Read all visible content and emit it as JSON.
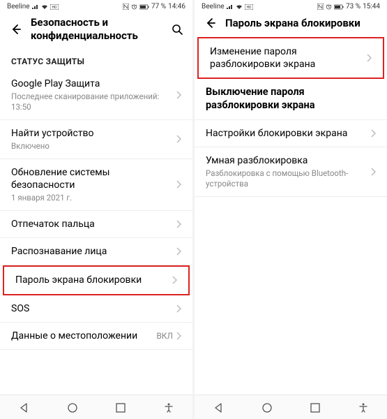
{
  "left": {
    "statusbar": {
      "carrier": "Beeline",
      "battery": "77 %",
      "time": "14:46"
    },
    "header": {
      "title": "Безопасность и конфиденциальность"
    },
    "section_label": "СТАТУС ЗАЩИТЫ",
    "items": [
      {
        "title": "Google Play Защита",
        "sub": "Последнее сканирование приложений: 13:50"
      },
      {
        "title": "Найти устройство",
        "sub": "Включено"
      },
      {
        "title": "Обновление системы безопасности",
        "sub": "1 января 2021 г."
      },
      {
        "title": "Отпечаток пальца"
      },
      {
        "title": "Распознавание лица"
      },
      {
        "title": "Пароль экрана блокировки"
      },
      {
        "title": "SOS"
      },
      {
        "title": "Данные о местоположении",
        "value": "ВКЛ"
      }
    ]
  },
  "right": {
    "statusbar": {
      "carrier": "Beeline",
      "battery": "73 %",
      "time": "15:44"
    },
    "header": {
      "title": "Пароль экрана блокировки"
    },
    "items": [
      {
        "title": "Изменение пароля разблокировки экрана"
      },
      {
        "title": "Выключение пароля разблокировки экрана",
        "bold": true
      },
      {
        "title": "Настройки блокировки экрана"
      },
      {
        "title": "Умная разблокировка",
        "sub": "Разблокировка с помощью Bluetooth-устройства"
      }
    ]
  }
}
